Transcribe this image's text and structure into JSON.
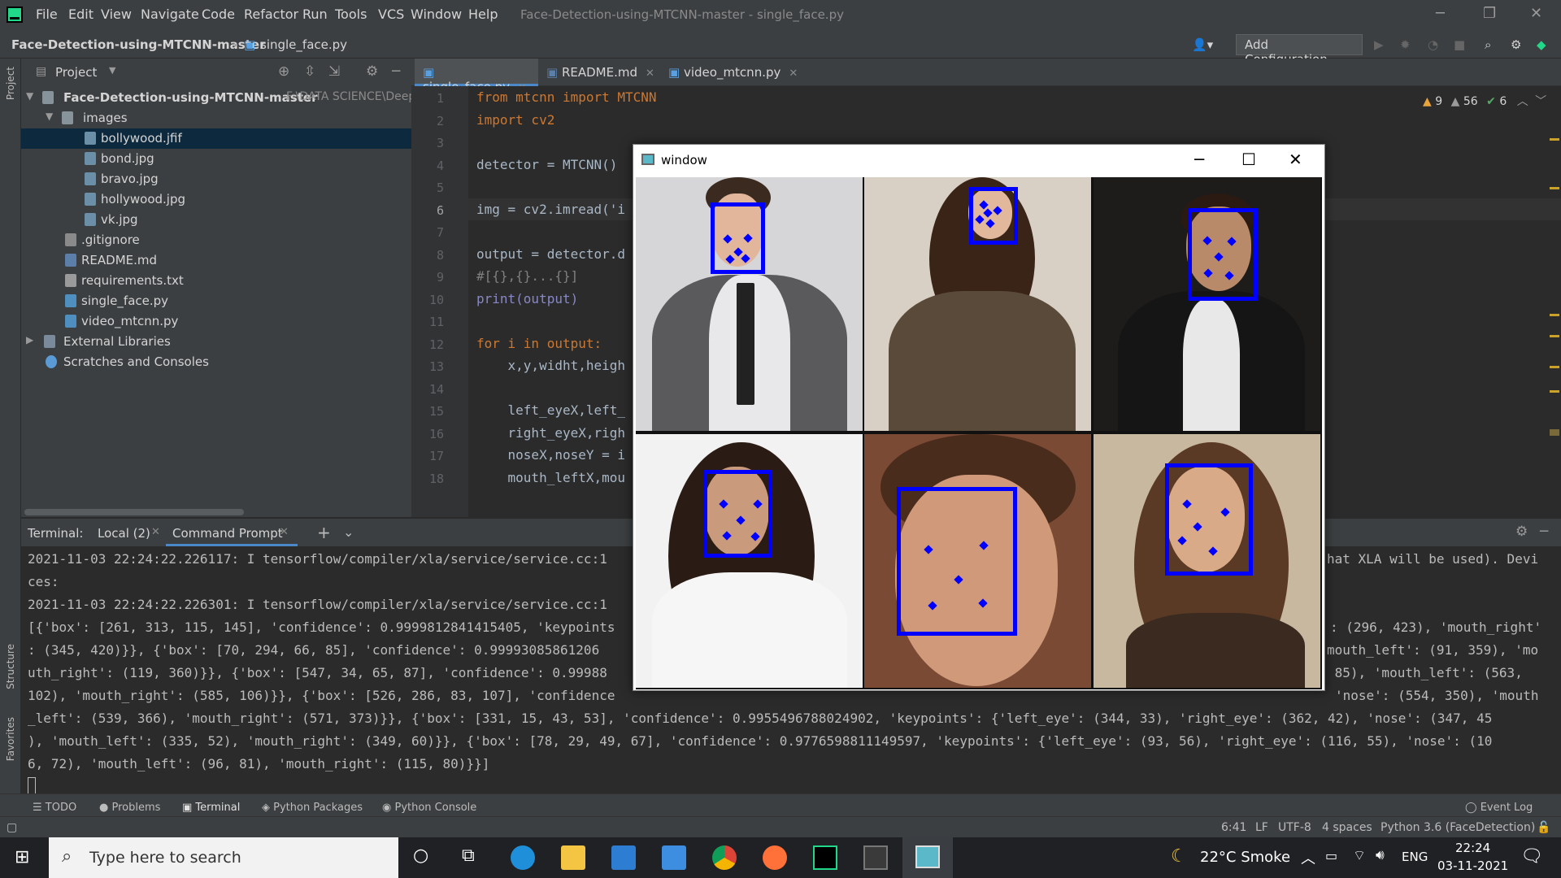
{
  "menu": [
    "File",
    "Edit",
    "View",
    "Navigate",
    "Code",
    "Refactor",
    "Run",
    "Tools",
    "VCS",
    "Window",
    "Help"
  ],
  "window_title": "Face-Detection-using-MTCNN-master - single_face.py",
  "breadcrumb": {
    "project": "Face-Detection-using-MTCNN-master",
    "file": "single_face.py"
  },
  "add_config": "Add Configuration...",
  "project_panel": {
    "title": "Project",
    "root": "Face-Detection-using-MTCNN-master",
    "root_path": "F:\\DATA SCIENCE\\Deep",
    "items": [
      {
        "label": "images",
        "type": "folder"
      },
      {
        "label": "bollywood.jfif",
        "type": "image"
      },
      {
        "label": "bond.jpg",
        "type": "image"
      },
      {
        "label": "bravo.jpg",
        "type": "image"
      },
      {
        "label": "hollywood.jpg",
        "type": "image"
      },
      {
        "label": "vk.jpg",
        "type": "image"
      },
      {
        "label": ".gitignore",
        "type": "file"
      },
      {
        "label": "README.md",
        "type": "md"
      },
      {
        "label": "requirements.txt",
        "type": "txt"
      },
      {
        "label": "single_face.py",
        "type": "py"
      },
      {
        "label": "video_mtcnn.py",
        "type": "py"
      },
      {
        "label": "External Libraries",
        "type": "lib"
      },
      {
        "label": "Scratches and Consoles",
        "type": "scratch"
      }
    ]
  },
  "tabs": [
    "single_face.py",
    "README.md",
    "video_mtcnn.py"
  ],
  "inspections": {
    "warnings": "9",
    "weak": "56",
    "ok": "6"
  },
  "code_lines": [
    "from mtcnn import MTCNN",
    "import cv2",
    "",
    "detector = MTCNN()",
    "",
    "img = cv2.imread('i",
    "",
    "output = detector.d",
    "#[{},{}...{}]",
    "print(output)",
    "",
    "for i in output:",
    "    x,y,widht,heigh",
    "",
    "    left_eyeX,left_",
    "    right_eyeX,righ",
    "    noseX,noseY = i",
    "    mouth_leftX,mou"
  ],
  "line_numbers": [
    "1",
    "2",
    "3",
    "4",
    "5",
    "6",
    "7",
    "8",
    "9",
    "10",
    "11",
    "12",
    "13",
    "14",
    "15",
    "16",
    "17",
    "18"
  ],
  "terminal": {
    "label": "Terminal:",
    "tabs": [
      "Local (2)",
      "Command Prompt"
    ],
    "lines": [
      "2021-11-03 22:24:22.226117: I tensorflow/compiler/xla/service/service.cc:1",
      "ces:",
      "2021-11-03 22:24:22.226301: I tensorflow/compiler/xla/service/service.cc:1",
      "[{'box': [261, 313, 115, 145], 'confidence': 0.9999812841415405, 'keypoints",
      ": (345, 420)}}, {'box': [70, 294, 66, 85], 'confidence': 0.99993085861206",
      "uth_right': (119, 360)}}, {'box': [547, 34, 65, 87], 'confidence': 0.99988",
      "102), 'mouth_right': (585, 106)}}, {'box': [526, 286, 83, 107], 'confidence",
      "_left': (539, 366), 'mouth_right': (571, 373)}}, {'box': [331, 15, 43, 53], 'confidence': 0.9955496788024902, 'keypoints': {'left_eye': (344, 33), 'right_eye': (362, 42), 'nose': (347, 45",
      "), 'mouth_left': (335, 52), 'mouth_right': (349, 60)}}, {'box': [78, 29, 49, 67], 'confidence': 0.9776598811149597, 'keypoints': {'left_eye': (93, 56), 'right_eye': (116, 55), 'nose': (10",
      "6, 72), 'mouth_left': (96, 81), 'mouth_right': (115, 80)}}]"
    ],
    "right_fragments": [
      "hat XLA will be used). Devi",
      ": (296, 423), 'mouth_right'",
      "mouth_left': (91, 359), 'mo",
      " 85), 'mouth_left': (563,",
      "'nose': (554, 350), 'mouth"
    ]
  },
  "tool_windows": [
    "TODO",
    "Problems",
    "Terminal",
    "Python Packages",
    "Python Console",
    "Event Log"
  ],
  "status": {
    "position": "6:41",
    "line_sep": "LF",
    "encoding": "UTF-8",
    "indent": "4 spaces",
    "interpreter": "Python 3.6 (FaceDetection)"
  },
  "cv_window": {
    "title": "window"
  },
  "sidebar_vertical": {
    "project": "Project",
    "structure": "Structure",
    "favorites": "Favorites"
  },
  "taskbar": {
    "search_placeholder": "Type here to search",
    "weather": "22°C  Smoke",
    "lang": "ENG",
    "time": "22:24",
    "date": "03-11-2021"
  }
}
